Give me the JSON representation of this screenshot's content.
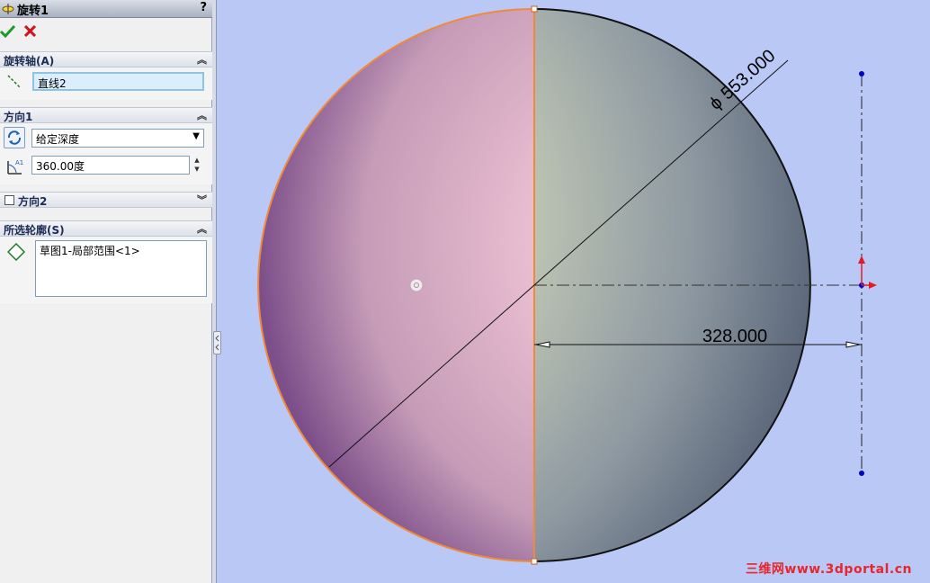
{
  "panel": {
    "title": "旋转1",
    "help": "?",
    "sections": {
      "axis": {
        "header": "旋转轴(A)",
        "value": "直线2"
      },
      "dir1": {
        "header": "方向1",
        "type": "给定深度",
        "angle": "360.00度"
      },
      "dir2": {
        "header": "方向2"
      },
      "contours": {
        "header": "所选轮廓(S)",
        "items": [
          "草图1-局部范围<1>"
        ]
      }
    }
  },
  "drawing": {
    "diameter_dim": "553.000",
    "diameter_symbol": "ϕ",
    "distance_dim": "328.000"
  },
  "watermark": "三维网www.3dportal.cn"
}
